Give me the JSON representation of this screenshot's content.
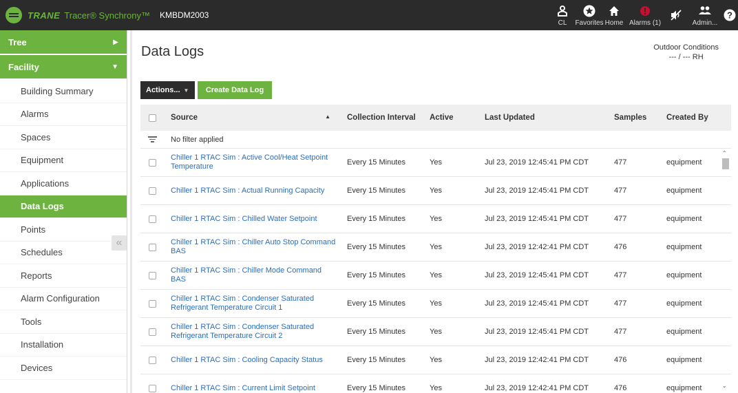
{
  "header": {
    "brand": "TRANE",
    "product": "Tracer® Synchrony™",
    "site": "KMBDM2003",
    "nav": [
      {
        "label": "CL",
        "icon": "person-icon"
      },
      {
        "label": "Favorites",
        "icon": "star-icon"
      },
      {
        "label": "Home",
        "icon": "home-icon"
      },
      {
        "label": "Alarms (1)",
        "icon": "alarm-icon"
      },
      {
        "label": "",
        "icon": "mute-icon"
      },
      {
        "label": "Admin...",
        "icon": "users-icon"
      },
      {
        "label": "",
        "icon": "help-icon"
      }
    ],
    "alarm_color": "#c8102e"
  },
  "sidebar": {
    "tree_label": "Tree",
    "facility_label": "Facility",
    "items": [
      {
        "label": "Building Summary"
      },
      {
        "label": "Alarms"
      },
      {
        "label": "Spaces"
      },
      {
        "label": "Equipment"
      },
      {
        "label": "Applications"
      },
      {
        "label": "Data Logs",
        "active": true
      },
      {
        "label": "Points"
      },
      {
        "label": "Schedules"
      },
      {
        "label": "Reports"
      },
      {
        "label": "Alarm Configuration"
      },
      {
        "label": "Tools"
      },
      {
        "label": "Installation"
      },
      {
        "label": "Devices"
      }
    ]
  },
  "main": {
    "title": "Data Logs",
    "outdoor_title": "Outdoor Conditions",
    "outdoor_value": "--- / --- RH",
    "actions_label": "Actions...",
    "create_label": "Create Data Log"
  },
  "table": {
    "columns": {
      "source": "Source",
      "interval": "Collection Interval",
      "active": "Active",
      "updated": "Last Updated",
      "samples": "Samples",
      "created_by": "Created By"
    },
    "filter_text": "No filter applied",
    "rows": [
      {
        "source": "Chiller 1 RTAC Sim : Active Cool/Heat Setpoint Temperature",
        "interval": "Every 15 Minutes",
        "active": "Yes",
        "updated": "Jul 23, 2019 12:45:41 PM CDT",
        "samples": "477",
        "created_by": "equipment"
      },
      {
        "source": "Chiller 1 RTAC Sim : Actual Running Capacity",
        "interval": "Every 15 Minutes",
        "active": "Yes",
        "updated": "Jul 23, 2019 12:45:41 PM CDT",
        "samples": "477",
        "created_by": "equipment"
      },
      {
        "source": "Chiller 1 RTAC Sim : Chilled Water Setpoint",
        "interval": "Every 15 Minutes",
        "active": "Yes",
        "updated": "Jul 23, 2019 12:45:41 PM CDT",
        "samples": "477",
        "created_by": "equipment"
      },
      {
        "source": "Chiller 1 RTAC Sim : Chiller Auto Stop Command BAS",
        "interval": "Every 15 Minutes",
        "active": "Yes",
        "updated": "Jul 23, 2019 12:42:41 PM CDT",
        "samples": "476",
        "created_by": "equipment"
      },
      {
        "source": "Chiller 1 RTAC Sim : Chiller Mode Command BAS",
        "interval": "Every 15 Minutes",
        "active": "Yes",
        "updated": "Jul 23, 2019 12:45:41 PM CDT",
        "samples": "477",
        "created_by": "equipment"
      },
      {
        "source": "Chiller 1 RTAC Sim : Condenser Saturated Refrigerant Temperature Circuit 1",
        "interval": "Every 15 Minutes",
        "active": "Yes",
        "updated": "Jul 23, 2019 12:45:41 PM CDT",
        "samples": "477",
        "created_by": "equipment"
      },
      {
        "source": "Chiller 1 RTAC Sim : Condenser Saturated Refrigerant Temperature Circuit 2",
        "interval": "Every 15 Minutes",
        "active": "Yes",
        "updated": "Jul 23, 2019 12:45:41 PM CDT",
        "samples": "477",
        "created_by": "equipment"
      },
      {
        "source": "Chiller 1 RTAC Sim : Cooling Capacity Status",
        "interval": "Every 15 Minutes",
        "active": "Yes",
        "updated": "Jul 23, 2019 12:42:41 PM CDT",
        "samples": "476",
        "created_by": "equipment"
      },
      {
        "source": "Chiller 1 RTAC Sim : Current Limit Setpoint",
        "interval": "Every 15 Minutes",
        "active": "Yes",
        "updated": "Jul 23, 2019 12:42:41 PM CDT",
        "samples": "476",
        "created_by": "equipment"
      }
    ]
  }
}
